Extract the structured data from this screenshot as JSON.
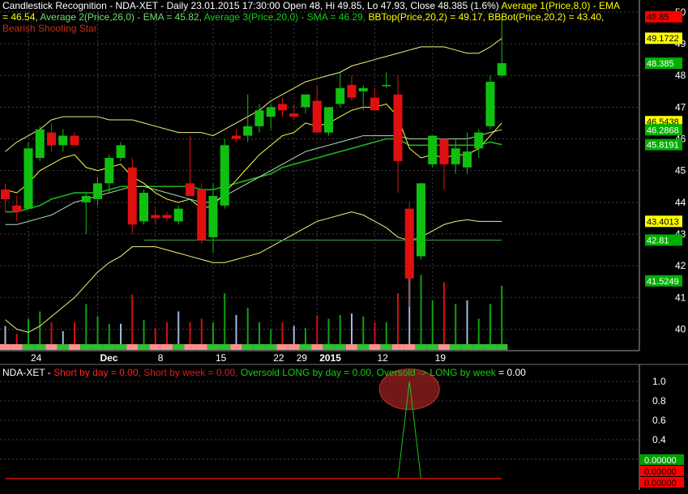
{
  "header": {
    "line1": {
      "lead": "Candlestick Recognition - NDA-XET - Daily 23.01.2015 17:30:00 Open 48, Hi 49.85, Lo 47.93, Close 48.385 (1.6%) ",
      "avg1": "Average 1(Price,8,0) - EMA"
    },
    "line2": {
      "avg1_val": "= 46.54, ",
      "avg2": "Average 2(Price,26,0) - EMA = 45.82, ",
      "avg3": "Average 3(Price,20,0) - SMA = 46.29, ",
      "bbtop": "BBTop(Price,20,2) = 49.17, ",
      "bbbot": "BBBot(Price,20,2) = 43.40,"
    },
    "line3": "Bearish Shooting Star"
  },
  "lower_header": {
    "symbol": "NDA-XET - ",
    "short_day": "Short by day = 0.00, ",
    "short_week": "Short by week = 0.00, ",
    "oversold_long": "Oversold LONG by day = 0.00, ",
    "oversold_week_label": "Oversold -> LONG by week",
    "oversold_week_val": " = 0.00"
  },
  "chart_data": [
    {
      "type": "candlestick",
      "title": "Candlestick Recognition - NDA-XET - Daily",
      "y_axis_ticks": [
        40,
        41,
        42,
        43,
        44,
        45,
        46,
        47,
        48,
        49,
        50
      ],
      "ylim": [
        39.35,
        50.25
      ],
      "x_tick_labels": [
        "24",
        "Dec",
        "8",
        "15",
        "22",
        "29",
        "2015",
        "12",
        "19"
      ],
      "x_tick_bar_index": [
        2,
        8,
        13,
        18,
        23,
        25,
        27,
        32,
        37
      ],
      "candles": [
        {
          "o": 44.4,
          "h": 44.6,
          "l": 43.7,
          "c": 44.1
        },
        {
          "o": 43.9,
          "h": 44.2,
          "l": 43.4,
          "c": 43.7
        },
        {
          "o": 43.8,
          "h": 45.9,
          "l": 43.8,
          "c": 45.7
        },
        {
          "o": 45.4,
          "h": 46.4,
          "l": 45.3,
          "c": 46.3
        },
        {
          "o": 46.2,
          "h": 46.5,
          "l": 45.6,
          "c": 45.8
        },
        {
          "o": 45.8,
          "h": 46.3,
          "l": 45.6,
          "c": 46.1
        },
        {
          "o": 46.1,
          "h": 46.2,
          "l": 45.8,
          "c": 45.8
        },
        {
          "o": 44.0,
          "h": 44.3,
          "l": 43.0,
          "c": 44.2
        },
        {
          "o": 44.1,
          "h": 44.8,
          "l": 43.9,
          "c": 44.6
        },
        {
          "o": 44.6,
          "h": 45.5,
          "l": 44.3,
          "c": 45.4
        },
        {
          "o": 45.4,
          "h": 45.9,
          "l": 45.3,
          "c": 45.8
        },
        {
          "o": 45.1,
          "h": 45.4,
          "l": 43.0,
          "c": 43.3
        },
        {
          "o": 43.4,
          "h": 44.4,
          "l": 43.3,
          "c": 44.3
        },
        {
          "o": 43.6,
          "h": 43.8,
          "l": 43.3,
          "c": 43.5
        },
        {
          "o": 43.6,
          "h": 43.7,
          "l": 43.4,
          "c": 43.5
        },
        {
          "o": 43.4,
          "h": 43.9,
          "l": 43.3,
          "c": 43.8
        },
        {
          "o": 44.6,
          "h": 46.1,
          "l": 44.3,
          "c": 44.2
        },
        {
          "o": 44.4,
          "h": 44.6,
          "l": 42.7,
          "c": 42.8
        },
        {
          "o": 42.9,
          "h": 44.6,
          "l": 42.4,
          "c": 44.2
        },
        {
          "o": 43.9,
          "h": 46.0,
          "l": 43.8,
          "c": 45.8
        },
        {
          "o": 46.1,
          "h": 46.3,
          "l": 45.9,
          "c": 46.0
        },
        {
          "o": 46.1,
          "h": 47.4,
          "l": 45.9,
          "c": 46.4
        },
        {
          "o": 46.4,
          "h": 47.1,
          "l": 46.2,
          "c": 46.9
        },
        {
          "o": 46.7,
          "h": 47.1,
          "l": 46.3,
          "c": 47.0
        },
        {
          "o": 47.1,
          "h": 47.3,
          "l": 46.7,
          "c": 46.9
        },
        {
          "o": 46.8,
          "h": 47.1,
          "l": 46.6,
          "c": 46.7
        },
        {
          "o": 47.0,
          "h": 47.4,
          "l": 46.8,
          "c": 47.4
        },
        {
          "o": 47.2,
          "h": 47.7,
          "l": 46.3,
          "c": 46.2
        },
        {
          "o": 46.2,
          "h": 47.0,
          "l": 46.1,
          "c": 47.0
        },
        {
          "o": 47.1,
          "h": 48.1,
          "l": 47.0,
          "c": 47.6
        },
        {
          "o": 47.7,
          "h": 48.0,
          "l": 47.2,
          "c": 47.3
        },
        {
          "o": 47.5,
          "h": 47.7,
          "l": 46.9,
          "c": 47.6
        },
        {
          "o": 47.3,
          "h": 47.6,
          "l": 46.9,
          "c": 46.9
        },
        {
          "o": 47.7,
          "h": 48.1,
          "l": 47.6,
          "c": 47.7
        },
        {
          "o": 47.4,
          "h": 48.0,
          "l": 44.3,
          "c": 45.3
        },
        {
          "o": 43.8,
          "h": 44.0,
          "l": 40.7,
          "c": 41.6
        },
        {
          "o": 42.3,
          "h": 44.6,
          "l": 42.2,
          "c": 44.6
        },
        {
          "o": 45.2,
          "h": 46.0,
          "l": 45.1,
          "c": 46.1
        },
        {
          "o": 46.0,
          "h": 46.0,
          "l": 44.4,
          "c": 45.2
        },
        {
          "o": 45.2,
          "h": 46.0,
          "l": 44.9,
          "c": 45.7
        },
        {
          "o": 45.1,
          "h": 46.2,
          "l": 44.9,
          "c": 45.6
        },
        {
          "o": 45.7,
          "h": 46.3,
          "l": 45.4,
          "c": 46.2
        },
        {
          "o": 46.4,
          "h": 48.0,
          "l": 46.3,
          "c": 47.8
        },
        {
          "o": 48.0,
          "h": 49.85,
          "l": 47.93,
          "c": 48.385
        }
      ],
      "overlays": {
        "ema8": [
          44.4,
          44.3,
          44.6,
          45.0,
          45.2,
          45.4,
          45.5,
          45.1,
          45.0,
          45.1,
          45.2,
          44.8,
          44.6,
          44.3,
          44.1,
          44.0,
          44.1,
          43.8,
          43.9,
          44.3,
          44.7,
          45.1,
          45.5,
          45.8,
          46.1,
          46.2,
          46.5,
          46.4,
          46.5,
          46.7,
          46.9,
          47.0,
          47.0,
          47.1,
          46.7,
          45.7,
          45.4,
          45.5,
          45.4,
          45.5,
          45.5,
          45.7,
          46.1,
          46.5
        ],
        "ema26": [
          43.7,
          43.7,
          43.8,
          43.9,
          44.1,
          44.2,
          44.3,
          44.3,
          44.3,
          44.4,
          44.5,
          44.5,
          44.5,
          44.5,
          44.5,
          44.5,
          44.5,
          44.4,
          44.4,
          44.5,
          44.6,
          44.7,
          44.8,
          44.9,
          45.1,
          45.2,
          45.3,
          45.4,
          45.5,
          45.6,
          45.7,
          45.8,
          45.9,
          46.0,
          46.0,
          45.8,
          45.8,
          45.8,
          45.8,
          45.8,
          45.8,
          45.8,
          45.9,
          45.82
        ],
        "sma20": [
          43.3,
          43.3,
          43.4,
          43.5,
          43.6,
          43.8,
          44.0,
          44.1,
          44.2,
          44.3,
          44.4,
          44.5,
          44.5,
          44.4,
          44.3,
          44.2,
          44.1,
          44.0,
          44.0,
          44.2,
          44.4,
          44.6,
          44.8,
          45.0,
          45.2,
          45.4,
          45.6,
          45.7,
          45.8,
          45.9,
          46.0,
          46.1,
          46.1,
          46.1,
          46.1,
          46.0,
          46.0,
          46.0,
          46.0,
          46.0,
          46.0,
          46.1,
          46.2,
          46.29
        ],
        "bb_top": [
          45.6,
          45.9,
          46.1,
          46.3,
          46.6,
          46.7,
          46.7,
          46.7,
          46.7,
          46.6,
          46.6,
          46.6,
          46.5,
          46.4,
          46.3,
          46.2,
          46.2,
          46.2,
          46.1,
          46.3,
          46.5,
          46.7,
          46.9,
          47.2,
          47.4,
          47.6,
          47.8,
          47.9,
          48.0,
          48.1,
          48.3,
          48.4,
          48.5,
          48.6,
          48.7,
          48.8,
          48.9,
          48.9,
          48.9,
          48.8,
          48.7,
          48.7,
          48.9,
          49.17
        ],
        "bb_bot": [
          40.3,
          40.0,
          39.9,
          40.1,
          40.4,
          40.7,
          41.0,
          41.4,
          41.8,
          42.1,
          42.3,
          42.6,
          42.6,
          42.6,
          42.5,
          42.4,
          42.3,
          42.2,
          42.1,
          42.1,
          42.2,
          42.3,
          42.4,
          42.6,
          42.8,
          43.0,
          43.2,
          43.4,
          43.5,
          43.6,
          43.7,
          43.6,
          43.4,
          43.2,
          42.9,
          42.8,
          42.9,
          43.1,
          43.3,
          43.4,
          43.45,
          43.4,
          43.4,
          43.4
        ]
      },
      "horizontal_level": 42.81,
      "price_labels": [
        {
          "text": "49.85",
          "value": 49.85,
          "bg": "#ff0000",
          "fg": "#000000"
        },
        {
          "text": "49.1722",
          "value": 49.1722,
          "bg": "#ffff00",
          "fg": "#000000"
        },
        {
          "text": "48.385",
          "value": 48.385,
          "bg": "#00b000",
          "fg": "#ffffff"
        },
        {
          "text": "46.5438",
          "value": 46.5438,
          "bg": "#ffff00",
          "fg": "#000000"
        },
        {
          "text": "46.2868",
          "value": 46.2868,
          "bg": "#00b000",
          "fg": "#ffffff"
        },
        {
          "text": "45.8191",
          "value": 45.8191,
          "bg": "#00b000",
          "fg": "#ffffff"
        },
        {
          "text": "43.4013",
          "value": 43.4013,
          "bg": "#ffff00",
          "fg": "#000000"
        },
        {
          "text": "42.81",
          "value": 42.81,
          "bg": "#00b000",
          "fg": "#ffffff"
        },
        {
          "text": "41.5249",
          "value": 41.5249,
          "bg": "#00b000",
          "fg": "#ffffff"
        }
      ],
      "volume_relative": [
        0.25,
        0.14,
        0.35,
        0.45,
        0.3,
        0.18,
        0.3,
        0.55,
        0.38,
        0.28,
        0.28,
        0.68,
        0.33,
        0.22,
        0.3,
        0.45,
        0.3,
        0.35,
        0.3,
        0.7,
        0.4,
        0.5,
        0.3,
        0.2,
        0.3,
        0.25,
        0.22,
        0.4,
        0.35,
        0.4,
        0.42,
        0.38,
        0.3,
        0.3,
        0.7,
        1.0,
        0.95,
        0.6,
        0.85,
        0.55,
        0.6,
        0.35,
        0.55,
        0.8
      ],
      "colors": {
        "up": "#10c010",
        "down": "#e01010",
        "ema8": "#ffff40",
        "ema26": "#20b020",
        "sma20": "#b0e0b0",
        "bollinger": "#f0f080",
        "level": "#40a040",
        "grid": "#404040"
      }
    },
    {
      "type": "line",
      "title": "NDA-XET",
      "y_axis_ticks": [
        0.2,
        0.4,
        0.6,
        0.8,
        1.0
      ],
      "ylim": [
        -0.05,
        1.05
      ],
      "series": [
        {
          "name": "Oversold -> LONG by week",
          "values": [
            0,
            0,
            0,
            0,
            0,
            0,
            0,
            0,
            0,
            0,
            0,
            0,
            0,
            0,
            0,
            0,
            0,
            0,
            0,
            0,
            0,
            0,
            0,
            0,
            0,
            0,
            0,
            0,
            0,
            0,
            0,
            0,
            0,
            0,
            0,
            1,
            0,
            0,
            0,
            0,
            0,
            0,
            0,
            0
          ]
        },
        {
          "name": "Short by day",
          "values": [
            0,
            0,
            0,
            0,
            0,
            0,
            0,
            0,
            0,
            0,
            0,
            0,
            0,
            0,
            0,
            0,
            0,
            0,
            0,
            0,
            0,
            0,
            0,
            0,
            0,
            0,
            0,
            0,
            0,
            0,
            0,
            0,
            0,
            0,
            0,
            0,
            0,
            0,
            0,
            0,
            0,
            0,
            0,
            0
          ]
        }
      ],
      "value_labels": [
        {
          "text": "0.00000",
          "bg": "#00a000",
          "fg": "#ffffff"
        },
        {
          "text": "0.00000",
          "bg": "#ff0000",
          "fg": "#000000"
        },
        {
          "text": "0.00000",
          "bg": "#ff0000",
          "fg": "#000000"
        }
      ]
    }
  ]
}
